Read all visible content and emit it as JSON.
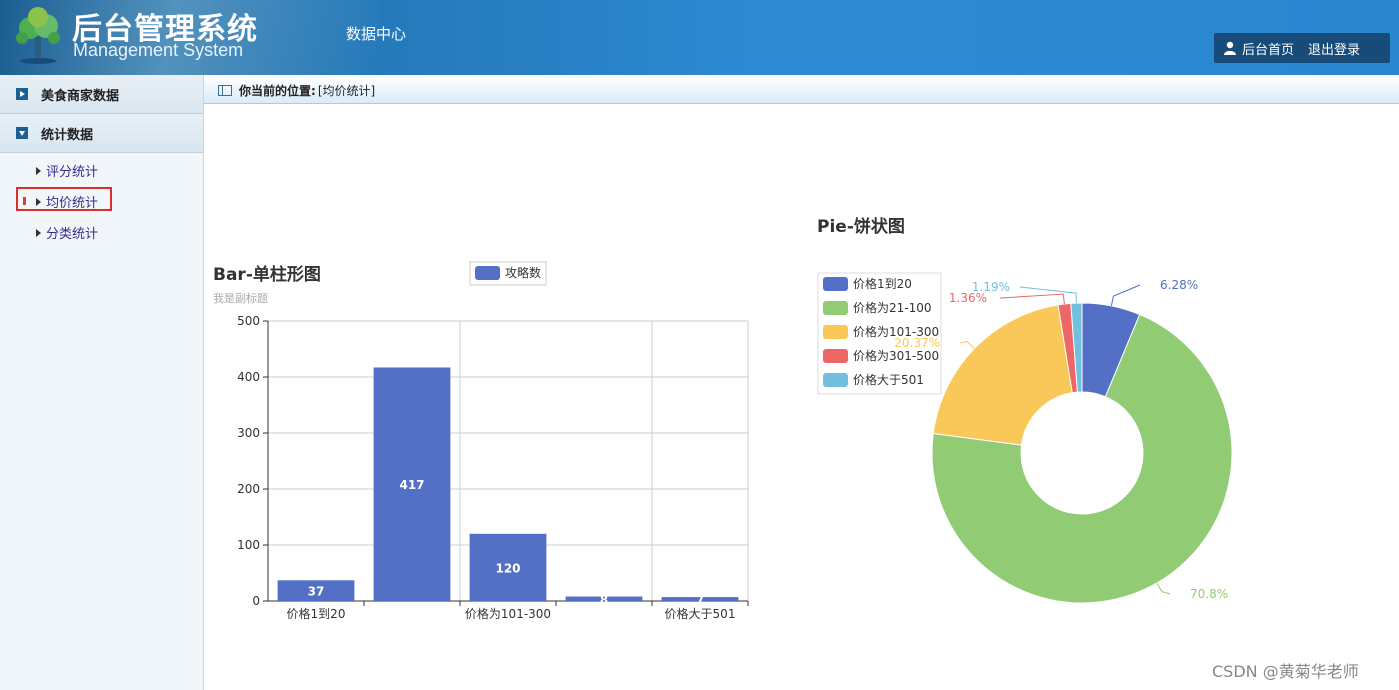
{
  "header": {
    "title": "后台管理系统",
    "subtitle": "Management System",
    "nav_center": "数据中心",
    "home_label": "后台首页",
    "logout_label": "退出登录"
  },
  "sidebar": {
    "groups": [
      {
        "label": "美食商家数据",
        "icon": "play-right-icon"
      },
      {
        "label": "统计数据",
        "icon": "play-down-icon"
      }
    ],
    "items": [
      {
        "label": "评分统计"
      },
      {
        "label": "均价统计",
        "active": true
      },
      {
        "label": "分类统计"
      }
    ]
  },
  "breadcrumb": {
    "prefix": "你当前的位置:",
    "current": "[均价统计]"
  },
  "watermark": "CSDN @黄菊华老师",
  "colors": {
    "bar": "#5470c6",
    "pie": [
      "#5470c6",
      "#91cc75",
      "#fac858",
      "#ee6666",
      "#73c0de"
    ]
  },
  "chart_data": [
    {
      "type": "bar",
      "title": "Bar-单柱形图",
      "subtitle": "我是副标题",
      "legend": [
        "攻略数"
      ],
      "categories": [
        "价格1到20",
        "价格为21-100",
        "价格为101-300",
        "价格为301-500",
        "价格大于501"
      ],
      "x_tick_labels": [
        "价格1到20",
        "",
        "价格为101-300",
        "",
        "价格大于501"
      ],
      "values": [
        37,
        417,
        120,
        8,
        7
      ],
      "ylim": [
        0,
        500
      ],
      "yticks": [
        0,
        100,
        200,
        300,
        400,
        500
      ],
      "grid": true
    },
    {
      "type": "pie",
      "title": "Pie-饼状图",
      "legend_position": "top-left",
      "labels": [
        "价格1到20",
        "价格为21-100",
        "价格为101-300",
        "价格为301-500",
        "价格大于501"
      ],
      "values": [
        6.28,
        70.8,
        20.37,
        1.36,
        1.19
      ],
      "value_labels": [
        "6.28%",
        "70.8%",
        "20.37%",
        "1.36%",
        "1.19%"
      ],
      "donut": true
    }
  ]
}
